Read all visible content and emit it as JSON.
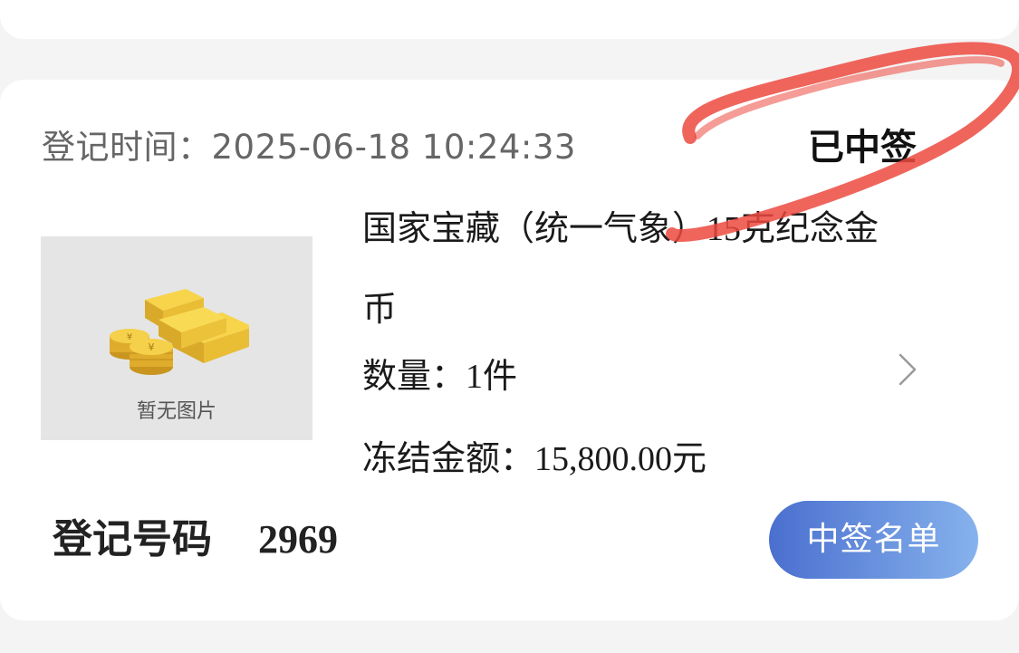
{
  "record": {
    "time_label": "登记时间：",
    "time_value": "2025-06-18 10:24:33",
    "status": "已中签",
    "image_placeholder": "暂无图片",
    "title_part1": "国家宝藏（统一气象）",
    "title_num": "15",
    "title_part2": "克纪念金币",
    "qty_label": "数量：",
    "qty_value": "1",
    "qty_unit": "件",
    "frozen_label": "冻结金额：",
    "frozen_value": "15,800.00",
    "frozen_unit": "元",
    "reg_label": "登记号码",
    "reg_number": "2969",
    "button_label": "中签名单"
  },
  "colors": {
    "button_start": "#4a6fcf",
    "button_end": "#86b2ec",
    "annotation": "#e8433a"
  },
  "icons": {
    "thumbnail": "gold-bars-coins-icon",
    "arrow": "chevron-right-icon"
  }
}
